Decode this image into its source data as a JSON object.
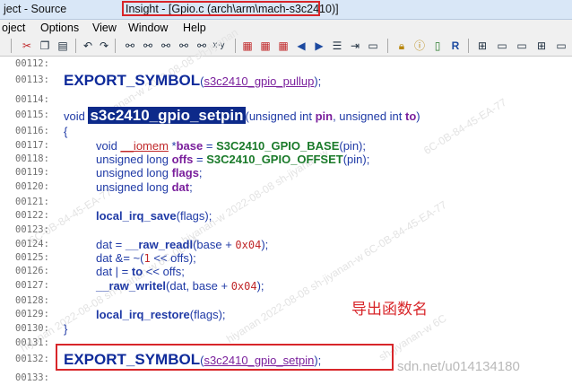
{
  "titlebar": {
    "prefix": "ject - Source ",
    "highlighted": "Insight - [Gpio.c (arch\\arm\\mach-s3c2410)]"
  },
  "menu": [
    "oject",
    "Options",
    "View",
    "Window",
    "Help"
  ],
  "toolbar_icons": [
    "cut-icon",
    "copy-icon",
    "paste-icon",
    "undo-icon",
    "redo-icon",
    "find-icon",
    "find-previous-icon",
    "find-next-icon",
    "replace-icon",
    "xy-icon",
    "bookmark-icon",
    "bookmark-add-icon",
    "back-icon",
    "forward-icon",
    "list-icon",
    "jump-icon",
    "lock-icon",
    "info-icon",
    "book-icon",
    "symbol-icon",
    "window-tile-icon",
    "window-icon",
    "window-split-icon"
  ],
  "code": {
    "ln_112": "00112:",
    "ln_113": "00113:",
    "line_113_symbol": "EXPORT_SYMBOL",
    "line_113_arg": "s3c2410_gpio_pullup",
    "line_113_tail": ");",
    "ln_114": "00114:",
    "ln_115": "00115:",
    "line_115_void": "void ",
    "line_115_fname": "s3c2410_gpio_setpin",
    "line_115_params_a": "(unsigned int ",
    "line_115_pin": "pin",
    "line_115_params_b": ", unsigned int ",
    "line_115_to": "to",
    "line_115_close": ")",
    "ln_116": "00116:",
    "line_116": "{",
    "ln_117": "00117:",
    "line_117_a": "void ",
    "line_117_iomem": "__iomem",
    "line_117_b": " *",
    "line_117_base": "base",
    "line_117_c": " = ",
    "line_117_macro": "S3C2410_GPIO_BASE",
    "line_117_d": "(pin);",
    "ln_118": "00118:",
    "line_118_a": "unsigned long ",
    "line_118_offs": "offs",
    "line_118_b": " = ",
    "line_118_macro": "S3C2410_GPIO_OFFSET",
    "line_118_c": "(pin);",
    "ln_119": "00119:",
    "line_119_a": "unsigned long ",
    "line_119_flags": "flags",
    "line_119_b": ";",
    "ln_120": "00120:",
    "line_120_a": "unsigned long ",
    "line_120_dat": "dat",
    "line_120_b": ";",
    "ln_121": "00121:",
    "ln_122": "00122:",
    "line_122_fn": "local_irq_save",
    "line_122_rest": "(flags);",
    "ln_123": "00123:",
    "ln_124": "00124:",
    "line_124_a": "dat = ",
    "line_124_fn": "__raw_readl",
    "line_124_b": "(base + ",
    "line_124_num": "0x04",
    "line_124_c": ");",
    "ln_125": "00125:",
    "line_125_a": "dat &= ~(",
    "line_125_num": "1",
    "line_125_b": " << offs);",
    "ln_126": "00126:",
    "line_126_a": "dat | = ",
    "line_126_to": "to",
    "line_126_b": " << offs;",
    "ln_127": "00127:",
    "line_127_fn": "__raw_writel",
    "line_127_a": "(dat, base + ",
    "line_127_num": "0x04",
    "line_127_b": ");",
    "ln_128": "00128:",
    "ln_129": "00129:",
    "line_129_fn": "local_irq_restore",
    "line_129_rest": "(flags);",
    "ln_130": "00130:",
    "line_130": "}",
    "ln_131": "00131:",
    "ln_132": "00132:",
    "line_132_symbol": "EXPORT_SYMBOL",
    "line_132_arg": "s3c2410_gpio_setpin",
    "line_132_tail": ");",
    "ln_133": "00133:"
  },
  "annotation": "导出函数名",
  "watermarks": [
    "hiyanan-w 2022-08-08 sh-jiyanan",
    "6C-0B-84-45-EA-77",
    "hiyanan-w 2022-08-08 sh-jiyanan-w",
    "6C-0B-84-45-EA-77",
    "hiyanan 2022-08-08 sh-jiyanan-w 6C-0B-84-45-EA-77",
    "hiyanan 2022-08-08 sh-jiyanan-w 6C-0B-84",
    "sh-jiyanan-w 6C"
  ],
  "watermark_url": "sdn.net/u014134180",
  "colors": {
    "annotation_red": "#d8262a",
    "highlight_bg": "#0d2a8a",
    "code_blue": "#1f3aa6"
  }
}
